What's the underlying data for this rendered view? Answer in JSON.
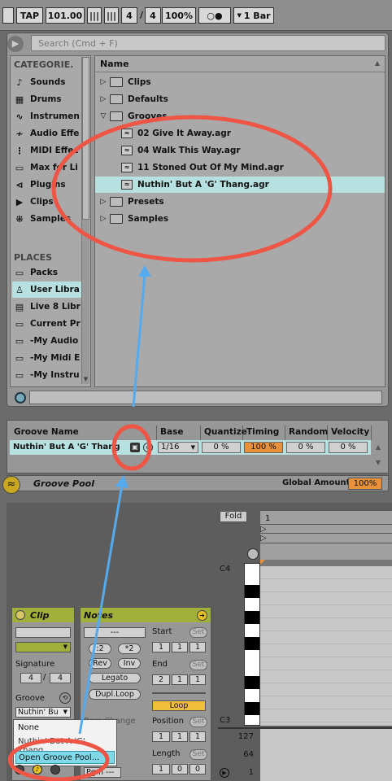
{
  "transport": {
    "tap": "TAP",
    "tempo": "101.00",
    "sig_num": "4",
    "sig_den": "4",
    "zoom": "100%",
    "quantize": "1 Bar"
  },
  "browser": {
    "search_placeholder": "Search (Cmd + F)",
    "categories_header": "CATEGORIE.",
    "categories": [
      "Sounds",
      "Drums",
      "Instrumen",
      "Audio Effe",
      "MIDI Effec",
      "Max for Li",
      "Plugins",
      "Clips",
      "Samples"
    ],
    "places_header": "PLACES",
    "places": [
      "Packs",
      "User Libra",
      "Live 8 Libr",
      "Current Pr",
      "-My Audio",
      "-My Midi E",
      "-My Instru"
    ],
    "name_header": "Name",
    "files": [
      {
        "label": "Clips",
        "kind": "folder",
        "state": "collapsed"
      },
      {
        "label": "Defaults",
        "kind": "folder",
        "state": "collapsed"
      },
      {
        "label": "Grooves",
        "kind": "folder",
        "state": "expanded"
      },
      {
        "label": "02 Give It Away.agr",
        "kind": "groove"
      },
      {
        "label": "04 Walk This Way.agr",
        "kind": "groove"
      },
      {
        "label": "11 Stoned Out Of My Mind.agr",
        "kind": "groove"
      },
      {
        "label": "Nuthin' But A 'G' Thang.agr",
        "kind": "groove",
        "selected": true
      },
      {
        "label": "Presets",
        "kind": "folder",
        "state": "collapsed"
      },
      {
        "label": "Samples",
        "kind": "folder",
        "state": "collapsed"
      }
    ]
  },
  "groove_pool": {
    "headers": [
      "Groove Name",
      "Base",
      "Quantize",
      "Timing",
      "Random",
      "Velocity"
    ],
    "row": {
      "name": "Nuthin' But A 'G' Thang",
      "base": "1/16",
      "quantize": "0 %",
      "timing": "100 %",
      "random": "0 %",
      "velocity": "0 %"
    },
    "title": "Groove Pool",
    "global_amount_label": "Global Amount",
    "global_amount": "100%"
  },
  "clip": {
    "title": "Clip",
    "signature_label": "Signature",
    "sig_num": "4",
    "sig_den": "4",
    "groove_label": "Groove",
    "groove_value": "Nuthin' Bu",
    "dropdown": [
      "None",
      "Nuthin' But A 'G' Thang",
      "Open Groove Pool..."
    ]
  },
  "notes": {
    "title": "Notes",
    "dashes": "---",
    "div2": ":2",
    "mul2": "*2",
    "rev": "Rev",
    "inv": "Inv",
    "legato": "Legato",
    "dupl": "Dupl.Loop",
    "start_label": "Start",
    "start": [
      "1",
      "1",
      "1"
    ],
    "end_label": "End",
    "end": [
      "2",
      "1",
      "1"
    ],
    "loop": "Loop",
    "position_label": "Position",
    "position": [
      "1",
      "1",
      "1"
    ],
    "length_label": "Length",
    "length": [
      "1",
      "0",
      "0"
    ],
    "set": "Set",
    "pgm_change": "Pgm Change",
    "pgm": "Pgm ---"
  },
  "piano": {
    "fold": "Fold",
    "bar1": "1",
    "c4": "C4",
    "c3": "C3",
    "vel": [
      "127",
      "64",
      "1"
    ]
  },
  "colors": {
    "highlight": "#b7e0e0",
    "olive": "#a0b03a",
    "orange": "#e8903a",
    "annotation": "#ee5544",
    "arrow": "#55aaee"
  }
}
